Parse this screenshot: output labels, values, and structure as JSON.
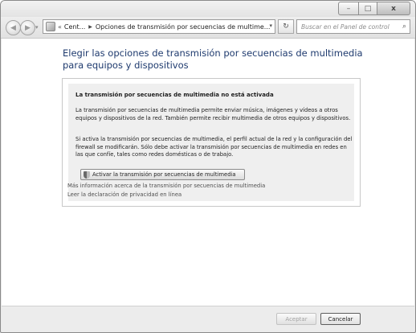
{
  "window": {
    "controls": {
      "minimize": "–",
      "maximize": "□",
      "close": "x"
    }
  },
  "nav": {
    "back_icon": "◀",
    "forward_icon": "▶",
    "history_icon": "▾",
    "breadcrumb": {
      "more": "«",
      "items": [
        "Cent...",
        "Opciones de transmisión por secuencias de multime..."
      ]
    },
    "dropdown_icon": "▾",
    "refresh_icon": "↻",
    "search_placeholder": "Buscar en el Panel de control",
    "search_icon": "⌕"
  },
  "main": {
    "heading": "Elegir las opciones de transmisión por secuencias de multimedia para equipos y dispositivos",
    "panel": {
      "title": "La transmisión por secuencias de multimedia no está activada",
      "paragraph1": "La transmisión por secuencias de multimedia permite enviar música, imágenes y vídeos a otros equipos y dispositivos de la red. También permite recibir multimedia de otros equipos y dispositivos.",
      "paragraph2": "Si activa la transmisión por secuencias de multimedia, el perfil actual de la red y la configuración del firewall se modificarán. Sólo debe activar la transmisión por secuencias de multimedia en redes en las que confíe, tales como redes domésticas o de trabajo.",
      "button": "Activar la transmisión por secuencias de multimedia"
    },
    "links": [
      "Más información acerca de la transmisión por secuencias de multimedia",
      "Leer la declaración de privacidad en línea"
    ]
  },
  "footer": {
    "ok": "Aceptar",
    "cancel": "Cancelar"
  }
}
